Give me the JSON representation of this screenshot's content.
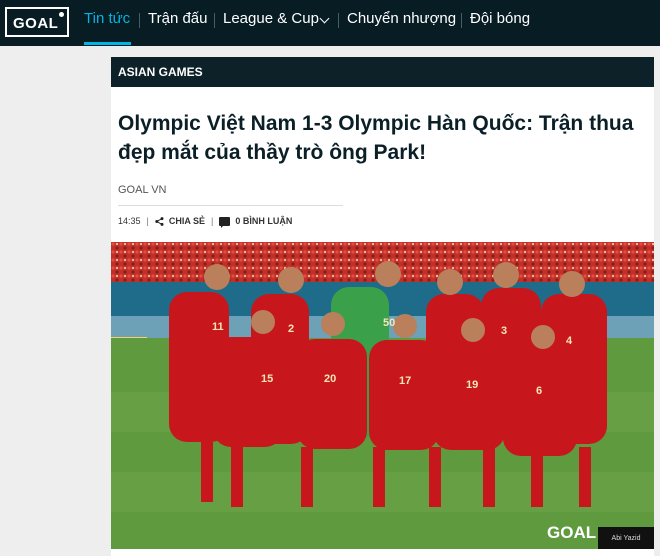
{
  "nav": {
    "logo": "GOAL",
    "items": [
      {
        "label": "Tin tức"
      },
      {
        "label": "Trận đấu"
      },
      {
        "label": "League & Cup"
      },
      {
        "label": "Chuyển nhượng"
      },
      {
        "label": "Đội bóng"
      }
    ],
    "accent_color": "#00b5e2",
    "bg_color": "#081c24"
  },
  "article": {
    "category": "ASIAN GAMES",
    "title": "Olympic Việt Nam 1-3 Olympic Hàn Quốc: Trận thua đẹp mắt của thầy trò ông Park!",
    "source": "GOAL VN",
    "time": "14:35",
    "share_label": "CHIA SẺ",
    "comments_label": "0 BÌNH LUẬN",
    "photo": {
      "watermark": "GOAL",
      "credit": "Abi Yazid",
      "back_row_numbers": [
        "11",
        "2",
        "50",
        "",
        "3",
        "4"
      ],
      "front_row_numbers": [
        "15",
        "20",
        "17",
        "19",
        "6"
      ],
      "jersey_color": "#c8161d",
      "keeper_color": "#3aa04a"
    }
  }
}
